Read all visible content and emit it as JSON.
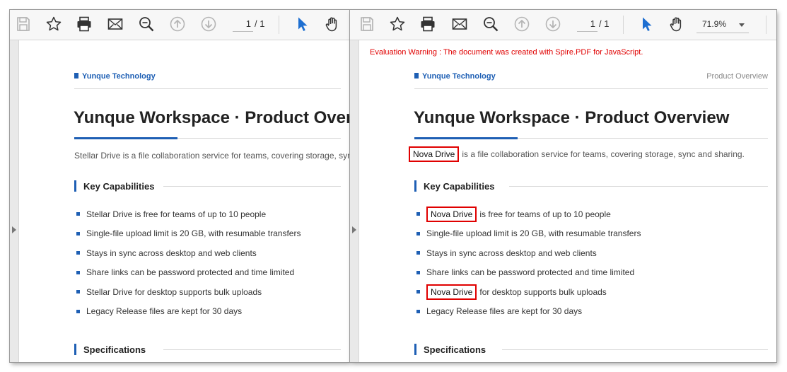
{
  "toolbar": {
    "page_current": "1",
    "page_total": "/ 1",
    "zoom": "71.9%",
    "icons": [
      "save-icon",
      "bookmark-star-icon",
      "print-icon",
      "email-icon",
      "zoom-search-icon",
      "previous-page-icon",
      "next-page-icon",
      "select-cursor-icon",
      "pan-hand-icon"
    ]
  },
  "left_doc": {
    "brand": "Yunque Technology",
    "title": "Yunque Workspace · Product Overview",
    "intro": "Stellar Drive is a file collaboration service for teams, covering storage, sync and sharing.",
    "section_capabilities": "Key Capabilities",
    "bullets": [
      "Stellar Drive is free for teams of up to 10 people",
      "Single-file upload limit is 20 GB, with resumable transfers",
      "Stays in sync across desktop and web clients",
      "Share links can be password protected and time limited",
      "Stellar Drive for desktop supports bulk uploads",
      "Legacy Release files are kept for 30 days"
    ],
    "section_specs": "Specifications"
  },
  "right_doc": {
    "eval_warning": "Evaluation Warning : The document was created with Spire.PDF for JavaScript.",
    "brand": "Yunque Technology",
    "header_right": "Product Overview",
    "title": "Yunque Workspace · Product Overview",
    "replaced_term": "Nova Drive",
    "intro_rest": "is a file collaboration service for teams, covering storage, sync and sharing.",
    "section_capabilities": "Key Capabilities",
    "bullet1_rest": "is free for teams of up to 10 people",
    "bullet2": "Single-file upload limit is 20 GB, with resumable transfers",
    "bullet3": "Stays in sync across desktop and web clients",
    "bullet4": "Share links can be password protected and time limited",
    "bullet5_rest": "for desktop supports bulk uploads",
    "bullet6": "Legacy Release files are kept for 30 days",
    "section_specs": "Specifications"
  },
  "colors": {
    "accent": "#1e5fb4",
    "highlight_box": "#e00000",
    "warning_text": "#e00000"
  }
}
